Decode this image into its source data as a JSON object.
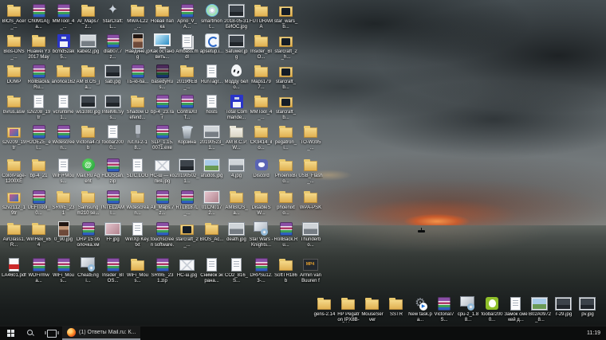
{
  "wallpaper": {
    "description": "storm clouds over sea at sunset",
    "colors": {
      "sky": "#555d61",
      "clouds_dark": "#23282b",
      "sea": "#1a1e1d",
      "sunset": "#e0713a",
      "taskbar": "#0c0d0d",
      "folder": "#e9c86d"
    }
  },
  "desktop": {
    "rows": [
      {
        "items": [
          {
            "label": "BIOS_Acer_...",
            "type": "folder"
          },
          {
            "label": "Ch0M1A(ja...",
            "type": "rar"
          },
          {
            "label": "MMTool_4_...",
            "type": "rar"
          },
          {
            "label": "AI_Maps7z...",
            "type": "folder"
          },
          {
            "label": "StarCraft: L...",
            "type": "star"
          },
          {
            "label": "MWA-L22_...",
            "type": "folder"
          },
          {
            "label": "Новая папка",
            "type": "folder"
          },
          {
            "label": "Aprio_V_A...",
            "type": "rar"
          },
          {
            "label": "smartmont...",
            "type": "disc"
          },
          {
            "label": "2018-05-31 БИОС.jpg",
            "type": "img-dark"
          },
          {
            "label": "FUTURAMA",
            "type": "folder"
          },
          {
            "label": "star_wars_b...",
            "type": "folder-dark"
          }
        ]
      },
      {
        "items": [
          {
            "label": "Bios-DNS_...",
            "type": "folder"
          },
          {
            "label": "Huawei Y3 2017 Maya...",
            "type": "folder"
          },
          {
            "label": "bcmd52ak5...",
            "type": "floppy"
          },
          {
            "label": "kabel2.jpg",
            "type": "img-bw"
          },
          {
            "label": "dlab07.7z...",
            "type": "rar"
          },
          {
            "label": "Наедине.jpg",
            "type": "photo"
          },
          {
            "label": "Как остановить...",
            "type": "monitor"
          },
          {
            "label": "Ambass.mdl",
            "type": "docs"
          },
          {
            "label": "apsetup.i...",
            "type": "appblue"
          },
          {
            "label": "Safuwer.jpg",
            "type": "img-dark"
          },
          {
            "label": "Insider_BIO...",
            "type": "folder"
          },
          {
            "label": "starcraft_2_h...",
            "type": "folder-dark"
          }
        ]
      },
      {
        "items": [
          {
            "label": "DUMP",
            "type": "folder"
          },
          {
            "label": "RollBack&Ru...",
            "type": "rar"
          },
          {
            "label": "anonce162",
            "type": "folder"
          },
          {
            "label": "AM B.OS_ja...",
            "type": "folder"
          },
          {
            "label": "sab.jpg",
            "type": "img-dark"
          },
          {
            "label": "ТБ-ю-ба...",
            "type": "rar"
          },
          {
            "label": "basedyRus...",
            "type": "rar-dark"
          },
          {
            "label": "2019ФЕВ_...",
            "type": "folder"
          },
          {
            "label": "RunTagr...",
            "type": "doc"
          },
          {
            "label": "Модду бело...",
            "type": "alien"
          },
          {
            "label": "Maps1797...",
            "type": "folder"
          },
          {
            "label": "starcraft_b...",
            "type": "folder-dark"
          }
        ]
      },
      {
        "items": [
          {
            "label": "bvrus.asw",
            "type": "folder"
          },
          {
            "label": "s2v208_19tr",
            "type": "doc"
          },
          {
            "label": "vcruntime1...",
            "type": "doc"
          },
          {
            "label": "ws1080.jpg",
            "type": "img-dark"
          },
          {
            "label": "IntelMESys...",
            "type": "img-dark"
          },
          {
            "label": "Shadow Defend...",
            "type": "folder"
          },
          {
            "label": "bp-4_23.rar",
            "type": "rar"
          },
          {
            "label": "ContraX0T...",
            "type": "rar"
          },
          {
            "label": "hosts",
            "type": "doc"
          },
          {
            "label": "Total Commande...",
            "type": "floppy"
          },
          {
            "label": "MMTool_4_...",
            "type": "folder"
          },
          {
            "label": "starcraft_b...",
            "type": "folder-dark"
          }
        ]
      },
      {
        "items": [
          {
            "label": "s2v209_19tr",
            "type": "folder-img"
          },
          {
            "label": "H2OEZE_el...",
            "type": "rar"
          },
          {
            "label": "Widescreen...",
            "type": "rar"
          },
          {
            "label": "Victoria473b",
            "type": "folder"
          },
          {
            "label": "foobar2000...",
            "type": "doc"
          },
          {
            "label": "rut.ru-2-18...",
            "type": "usb"
          },
          {
            "label": "SLP_1.15.0071.exe",
            "type": "rar"
          },
          {
            "label": "Корзина",
            "type": "bin"
          },
          {
            "label": "20190523_1...",
            "type": "img-bw"
          },
          {
            "label": "AM B.C.P.W...",
            "type": "folder-white"
          },
          {
            "label": "CK9414_ilo...",
            "type": "folder"
          },
          {
            "label": "pegatron_i...",
            "type": "folder"
          },
          {
            "label": "TO-W395_...",
            "type": "folder"
          }
        ]
      },
      {
        "items": [
          {
            "label": "ColorPage-1200XE",
            "type": "folder"
          },
          {
            "label": "bp-4_21",
            "type": "folder"
          },
          {
            "label": "WiFi+Mous...",
            "type": "doc"
          },
          {
            "label": "Mail.Ru Agent",
            "type": "mailru"
          },
          {
            "label": "HDDScan.zip",
            "type": "rar"
          },
          {
            "label": "SLIC.LOG",
            "type": "doc"
          },
          {
            "label": "HC-ш — копия.jpg",
            "type": "envelope"
          },
          {
            "label": "20190502_1...",
            "type": "img-dark"
          },
          {
            "label": "afudos.jpg",
            "type": "img"
          },
          {
            "label": "4.jpg",
            "type": "img-bw"
          },
          {
            "label": "Discord",
            "type": "discord"
          },
          {
            "label": "PhoenixBio...",
            "type": "folder"
          },
          {
            "label": "USB_Flash_...",
            "type": "folder"
          }
        ]
      },
      {
        "items": [
          {
            "label": "s2v2112_19tr",
            "type": "folder-img"
          },
          {
            "label": "UEFITool_0...",
            "type": "rar"
          },
          {
            "label": "SRWE_231",
            "type": "folder"
          },
          {
            "label": "Samsung m210 se...",
            "type": "folder"
          },
          {
            "label": "INTEL2AMI...",
            "type": "rar"
          },
          {
            "label": "Widescrean...",
            "type": "folder"
          },
          {
            "label": "All_Maps.7z...",
            "type": "rar"
          },
          {
            "label": "RTL8187L_...",
            "type": "rar"
          },
          {
            "label": "01CN0172...",
            "type": "img-pink"
          },
          {
            "label": "AMIBIOS_a...",
            "type": "folder"
          },
          {
            "label": "DisableSW...",
            "type": "folder"
          },
          {
            "label": "phoenixto...",
            "type": "folder"
          },
          {
            "label": "WPA-PSK",
            "type": "folder"
          }
        ]
      },
      {
        "items": [
          {
            "label": "AirGlass1.R...",
            "type": "folder"
          },
          {
            "label": "WinHex_x64",
            "type": "folder"
          },
          {
            "label": "0_90.jpg",
            "type": "photo"
          },
          {
            "label": "DRP 15 оболочка.хм",
            "type": "rar"
          },
          {
            "label": "FF.jpg",
            "type": "img-pink"
          },
          {
            "label": "WinXp Key.txt",
            "type": "doc"
          },
          {
            "label": "touchscreen software.rar",
            "type": "rar"
          },
          {
            "label": "starcraft_2_...",
            "type": "folder-dark"
          },
          {
            "label": "BIOS_Ac...",
            "type": "folder"
          },
          {
            "label": "death.jpg",
            "type": "img-bw"
          },
          {
            "label": "Star Wars - Knights...",
            "type": "installer"
          },
          {
            "label": "RollBack.Ru...",
            "type": "rar"
          },
          {
            "label": "Thunderbo...",
            "type": "img-bw"
          }
        ]
      },
      {
        "items": [
          {
            "label": "LA4601.pdf",
            "type": "pdf"
          },
          {
            "label": "WDFirmwa...",
            "type": "rar"
          },
          {
            "label": "WiFi_Mous...",
            "type": "rar"
          },
          {
            "label": "CheatEngi...",
            "type": "installer"
          },
          {
            "label": "Insider_BIOS...",
            "type": "rar"
          },
          {
            "label": "WiFi_Mous...",
            "type": "folder"
          },
          {
            "label": "SRWE_231.zip",
            "type": "rar"
          },
          {
            "label": "HC-ш.jpg",
            "type": "envelope"
          },
          {
            "label": "Снимок экрана...",
            "type": "doc"
          },
          {
            "label": "CO2_816_S...",
            "type": "doc"
          },
          {
            "label": "DRPSu12.3-...",
            "type": "rar"
          },
          {
            "label": "SoftTH186b",
            "type": "folder"
          },
          {
            "label": "Armin van Buuren fe...",
            "type": "mp4"
          }
        ]
      }
    ],
    "bottom_cluster": {
      "items": [
        {
          "label": "gens-2.14",
          "type": "folder"
        },
        {
          "label": "HP Pegatron IPX8B-DM ...",
          "type": "folder"
        },
        {
          "label": "MouseServer",
          "type": "folder"
        },
        {
          "label": "SSTR",
          "type": "folder"
        },
        {
          "label": "New task.pa...",
          "type": "gearplay"
        },
        {
          "label": "VictoriaI7S...",
          "type": "rar"
        },
        {
          "label": "cpu-z_1.88...",
          "type": "installer"
        },
        {
          "label": "foobar2000...",
          "type": "foobar"
        },
        {
          "label": "Замок смекей д...",
          "type": "doc"
        },
        {
          "label": "B02A0972_8...",
          "type": "img"
        },
        {
          "label": "r-29.jpg",
          "type": "img-dark"
        },
        {
          "label": "pv.jpg",
          "type": "img-dark"
        }
      ]
    }
  },
  "taskbar": {
    "start_tooltip": "Пуск",
    "app_button": {
      "label": "(1) Ответы Mail.ru: К..."
    },
    "clock": "11:19"
  }
}
